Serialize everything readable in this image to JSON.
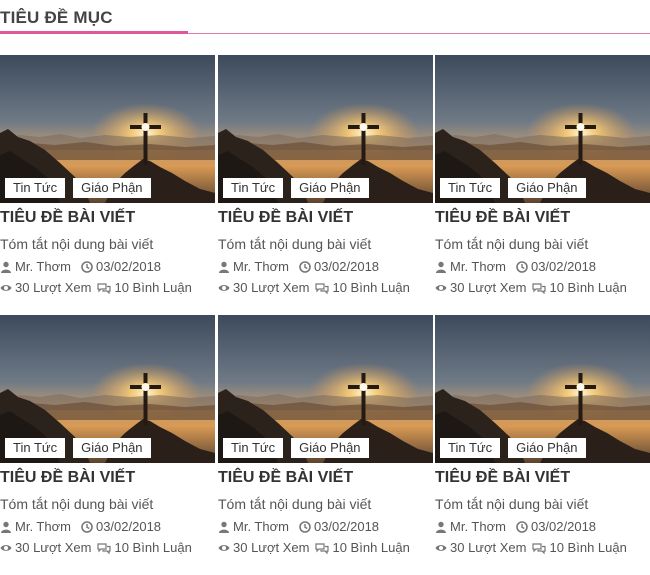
{
  "section": {
    "title": "TIÊU ĐỀ MỤC"
  },
  "colors": {
    "accent": "#e0579a"
  },
  "posts": [
    {
      "tags": [
        "Tin Tức",
        "Giáo Phận"
      ],
      "title": "TIÊU ĐỀ BÀI VIẾT",
      "summary": "Tóm tắt nội dung bài viết",
      "author": "Mr. Thơm",
      "date": "03/02/2018",
      "views": "30 Lượt Xem",
      "comments": "10 Bình Luận"
    },
    {
      "tags": [
        "Tin Tức",
        "Giáo Phận"
      ],
      "title": "TIÊU ĐỀ BÀI VIẾT",
      "summary": "Tóm tắt nội dung bài viết",
      "author": "Mr. Thơm",
      "date": "03/02/2018",
      "views": "30 Lượt Xem",
      "comments": "10 Bình Luận"
    },
    {
      "tags": [
        "Tin Tức",
        "Giáo Phận"
      ],
      "title": "TIÊU ĐỀ BÀI VIẾT",
      "summary": "Tóm tắt nội dung bài viết",
      "author": "Mr. Thơm",
      "date": "03/02/2018",
      "views": "30 Lượt Xem",
      "comments": "10 Bình Luận"
    },
    {
      "tags": [
        "Tin Tức",
        "Giáo Phận"
      ],
      "title": "TIÊU ĐỀ BÀI VIẾT",
      "summary": "Tóm tắt nội dung bài viết",
      "author": "Mr. Thơm",
      "date": "03/02/2018",
      "views": "30 Lượt Xem",
      "comments": "10 Bình Luận"
    },
    {
      "tags": [
        "Tin Tức",
        "Giáo Phận"
      ],
      "title": "TIÊU ĐỀ BÀI VIẾT",
      "summary": "Tóm tắt nội dung bài viết",
      "author": "Mr. Thơm",
      "date": "03/02/2018",
      "views": "30 Lượt Xem",
      "comments": "10 Bình Luận"
    },
    {
      "tags": [
        "Tin Tức",
        "Giáo Phận"
      ],
      "title": "TIÊU ĐỀ BÀI VIẾT",
      "summary": "Tóm tắt nội dung bài viết",
      "author": "Mr. Thơm",
      "date": "03/02/2018",
      "views": "30 Lượt Xem",
      "comments": "10 Bình Luận"
    }
  ],
  "icons": {
    "author": "user-icon",
    "date": "clock-icon",
    "views": "eye-icon",
    "comments": "comment-icon",
    "image": "cross-sunset-image"
  }
}
